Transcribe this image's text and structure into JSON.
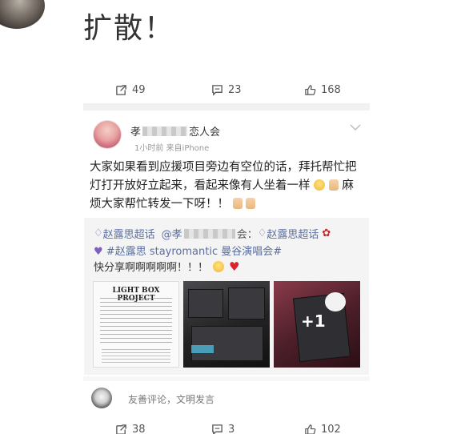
{
  "header": {
    "text": "扩散！"
  },
  "top_actions": {
    "repost": "49",
    "comment": "23",
    "like": "168"
  },
  "post": {
    "author_prefix": "孝",
    "author_suffix": "恋人会",
    "meta": "1小时前  来自iPhone",
    "text_part1": "大家如果看到应援项目旁边有空位的话，拜托帮忙把灯打开放好立起来，看起来像有人坐着一样",
    "text_part2": "麻烦大家帮忙转发一下呀！！"
  },
  "repost": {
    "topic1": "赵露思超话",
    "mention_prefix": "@孝",
    "mention_suffix": "会：",
    "topic2": "赵露思超话",
    "hashtag": "#赵露思 stayromantic 曼谷演唱会#",
    "share_text": "快分享啊啊啊啊啊！！！",
    "poster_title": "LIGHT BOX PROJECT",
    "thumb3_overlay": "+1"
  },
  "comment_box": {
    "placeholder": "友善评论，文明发言"
  },
  "bottom_actions": {
    "repost": "38",
    "comment": "3",
    "like": "102"
  },
  "icons": [
    "repost-icon",
    "comment-icon",
    "like-icon",
    "chevron-down-icon",
    "heart-icon",
    "rose-icon"
  ]
}
